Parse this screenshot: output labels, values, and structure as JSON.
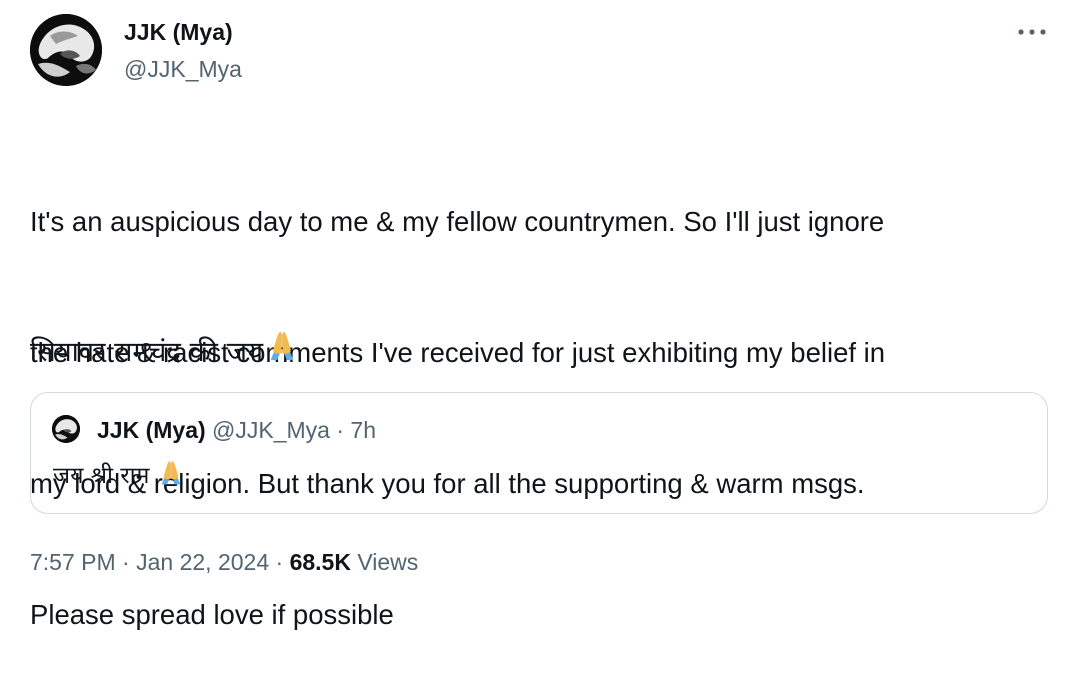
{
  "author": {
    "display_name": "JJK (Mya)",
    "handle": "@JJK_Mya"
  },
  "tweet": {
    "lines": [
      "It's an auspicious day to me & my fellow countrymen. So I'll just ignore",
      "the hate & racist comments I've received for just exhibiting my belief in",
      "my lord & religion. But thank you for all the supporting & warm msgs.",
      "Please spread love if possible"
    ],
    "hindi_line": "सियावर रामचंद्र की जय",
    "emoji_icon": "folded-hands-icon"
  },
  "quote": {
    "display_name": "JJK (Mya)",
    "meta": "@JJK_Mya · 7h",
    "text": "जय श्री राम"
  },
  "footer": {
    "time": "7:57 PM",
    "sep1": " · ",
    "date": "Jan 22, 2024",
    "sep2": " · ",
    "views_count": "68.5K",
    "views_label": " Views"
  },
  "colors": {
    "text_primary": "#0f1419",
    "text_secondary": "#536471",
    "border": "#cfd9de",
    "emoji_skin": "#F4BB4B",
    "emoji_sleeve": "#5DADEC"
  }
}
